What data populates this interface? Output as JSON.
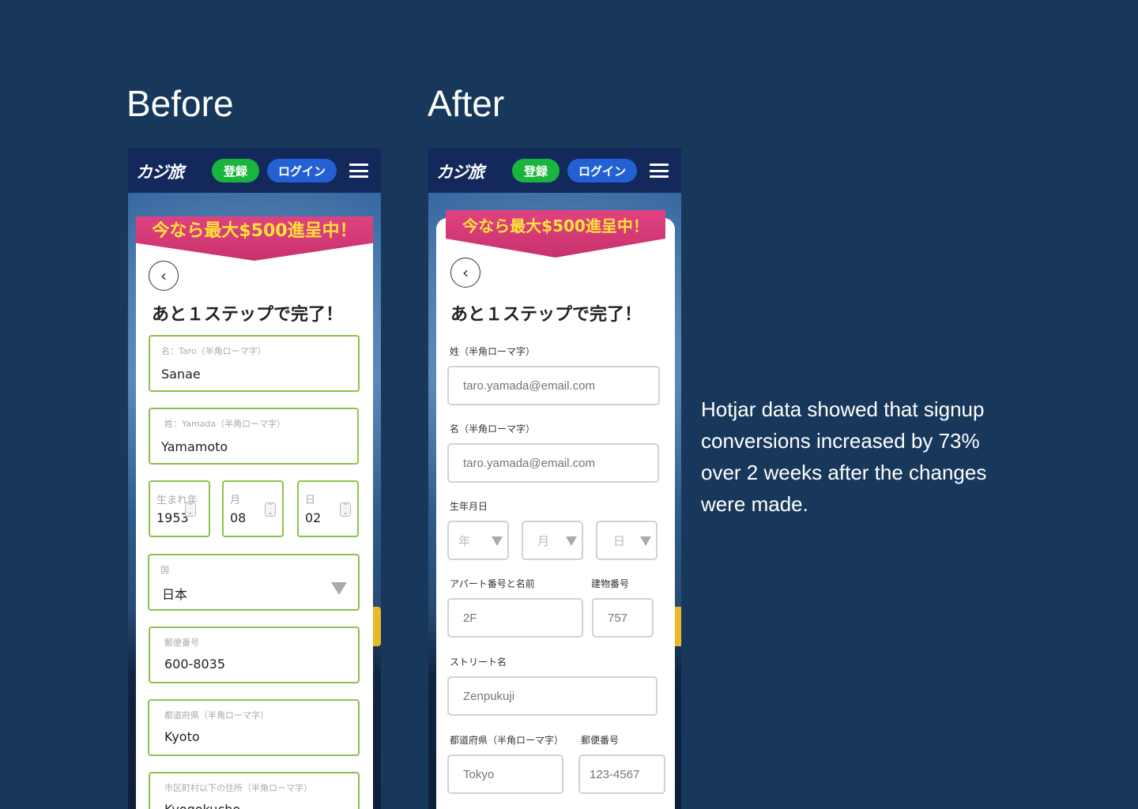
{
  "headings": {
    "before": "Before",
    "after": "After"
  },
  "nav": {
    "logo": "カジ旅",
    "register": "登録",
    "login": "ログイン"
  },
  "banner": "今なら最大$500進呈中！",
  "step_title": "あと１ステップで完了！",
  "before": {
    "first_name": {
      "label": "名：Taro（半角ローマ字）",
      "value": "Sanae"
    },
    "last_name": {
      "label": "姓：Yamada（半角ローマ字）",
      "value": "Yamamoto"
    },
    "birth_year": {
      "label": "生まれ年",
      "value": "1953"
    },
    "birth_month": {
      "label": "月",
      "value": "08"
    },
    "birth_day": {
      "label": "日",
      "value": "02"
    },
    "country": {
      "label": "国",
      "value": "日本"
    },
    "postal": {
      "label": "郵便番号",
      "value": "600-8035"
    },
    "prefecture": {
      "label": "都道府県（半角ローマ字）",
      "value": "Kyoto"
    },
    "address": {
      "label": "市区町村以下の住所（半角ローマ字）",
      "value": "Kyogokucho"
    }
  },
  "after": {
    "last_name": {
      "label": "姓（半角ローマ字）",
      "placeholder": "taro.yamada@email.com"
    },
    "first_name": {
      "label": "名（半角ローマ字）",
      "placeholder": "taro.yamada@email.com"
    },
    "birthdate": {
      "label": "生年月日",
      "year": "年",
      "month": "月",
      "day": "日"
    },
    "apartment": {
      "label": "アパート番号と名前",
      "placeholder": "2F"
    },
    "building": {
      "label": "建物番号",
      "placeholder": "757"
    },
    "street": {
      "label": "ストリート名",
      "placeholder": "Zenpukuji"
    },
    "prefecture": {
      "label": "都道府県（半角ローマ字）",
      "placeholder": "Tokyo"
    },
    "postal": {
      "label": "郵便番号",
      "placeholder": "123-4567"
    }
  },
  "caption": "Hotjar data showed that signup conversions increased by 73% over 2 weeks after the changes were made."
}
